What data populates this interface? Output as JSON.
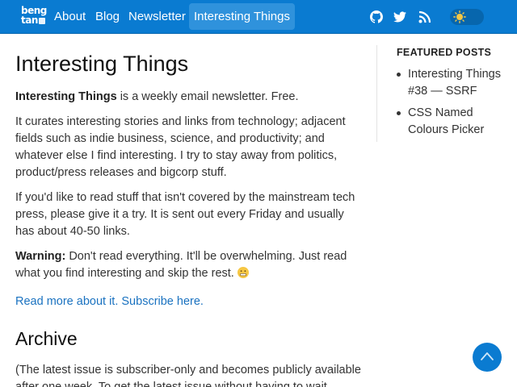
{
  "header": {
    "logo_line1": "beng",
    "logo_line2": "tan",
    "nav": [
      "About",
      "Blog",
      "Newsletter",
      "Interesting Things"
    ],
    "active_nav": "Interesting Things",
    "icons": [
      "github-icon",
      "twitter-icon",
      "rss-icon"
    ],
    "theme_toggle_icon": "sun-icon",
    "brand_color": "#0a7bd1"
  },
  "main": {
    "title": "Interesting Things",
    "intro_bold": "Interesting Things",
    "intro_rest": " is a weekly email newsletter. Free.",
    "p2": "It curates interesting stories and links from technology; adjacent fields such as indie business, science, and productivity; and whatever else I find interesting. I try to stay away from politics, product/press releases and bigcorp stuff.",
    "p3": "If you'd like to read stuff that isn't covered by the mainstream tech press, please give it a try. It is sent out every Friday and usually has about 40-50 links.",
    "warning_label": "Warning:",
    "warning_text": " Don't read everything. It'll be overwhelming. Just read what you find interesting and skip the rest. ",
    "read_more_link": "Read more about it.",
    "subscribe_link": "Subscribe here.",
    "archive_title": "Archive",
    "archive_text": "(The latest issue is subscriber-only and becomes publicly available after one week. To get the latest issue without having to wait,"
  },
  "sidebar": {
    "title": "FEATURED POSTS",
    "items": [
      "Interesting Things #38 — SSRF",
      "CSS Named Colours Picker"
    ]
  },
  "scroll_top_icon": "chevron-up-icon"
}
